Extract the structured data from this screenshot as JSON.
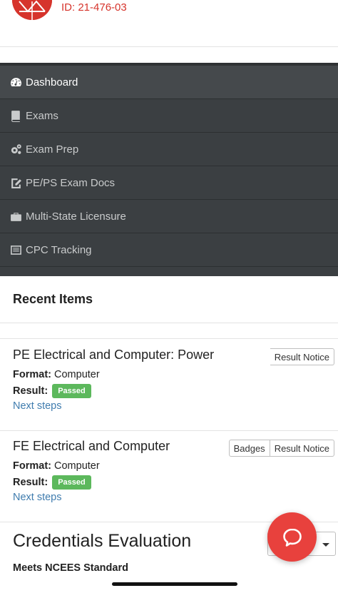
{
  "header": {
    "user_id": "ID: 21-476-03"
  },
  "nav": {
    "items": [
      {
        "label": "Dashboard",
        "icon": "dashboard-icon",
        "active": true
      },
      {
        "label": "Exams",
        "icon": "book-icon"
      },
      {
        "label": "Exam Prep",
        "icon": "gears-icon"
      },
      {
        "label": "PE/PS Exam Docs",
        "icon": "edit-document-icon"
      },
      {
        "label": "Multi-State Licensure",
        "icon": "briefcase-icon"
      },
      {
        "label": "CPC Tracking",
        "icon": "list-icon"
      }
    ]
  },
  "recent": {
    "title": "Recent Items",
    "items": [
      {
        "title": "PE Electrical and Computer: Power",
        "format_label": "Format:",
        "format_value": "Computer",
        "result_label": "Result:",
        "result_value": "Passed",
        "next_steps": "Next steps",
        "buttons": [
          "Result Notice"
        ]
      },
      {
        "title": "FE Electrical and Computer",
        "format_label": "Format:",
        "format_value": "Computer",
        "result_label": "Result:",
        "result_value": "Passed",
        "next_steps": "Next steps",
        "buttons": [
          "Badges",
          "Result Notice"
        ]
      }
    ]
  },
  "credentials": {
    "title": "Credentials Evaluation",
    "subtitle": "Meets NCEES Standard"
  },
  "colors": {
    "accent": "#d6342c",
    "nav_bg": "#3b3f42",
    "passed": "#5cb85c",
    "link": "#3f7cae",
    "chat": "#e8413d"
  }
}
